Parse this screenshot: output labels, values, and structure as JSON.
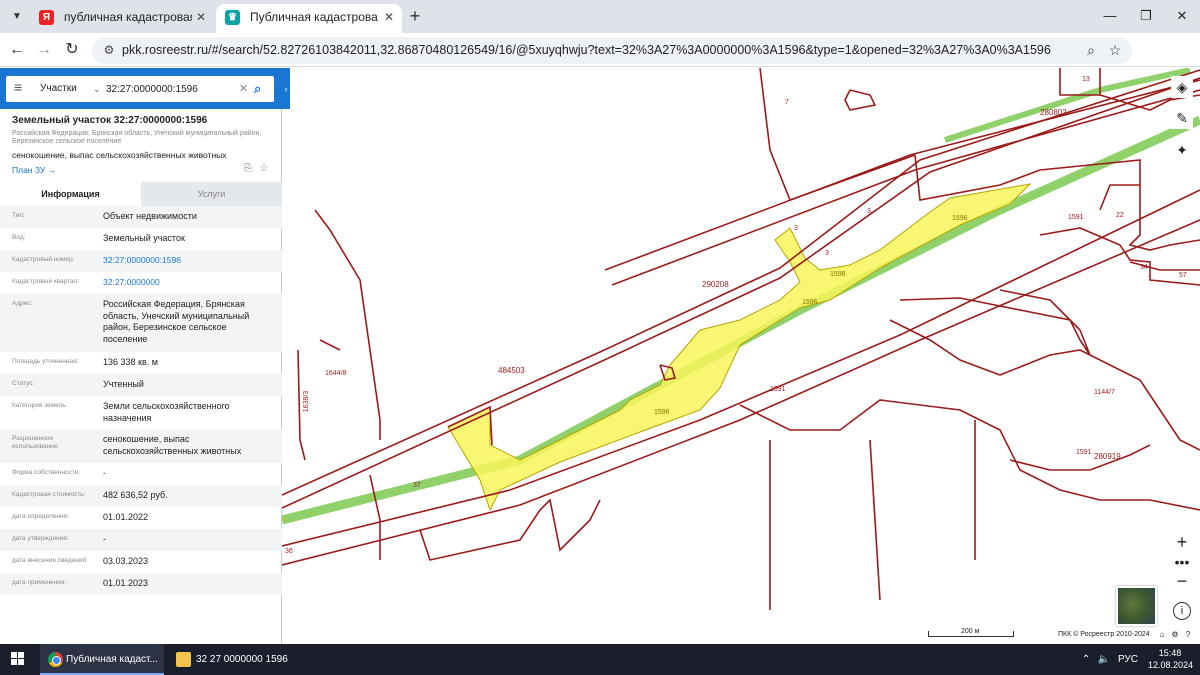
{
  "browser": {
    "tabs": [
      {
        "title": "публичная кадастровая карта",
        "favicon": "yandex-icon",
        "active": false
      },
      {
        "title": "Публичная кадастровая карта",
        "favicon": "rosreestr-icon",
        "active": true
      }
    ],
    "url": "pkk.rosreestr.ru/#/search/52.82726103842011,32.86870480126549/16/@5xuyqhwju?text=32%3A27%3A0000000%3A1596&type=1&opened=32%3A27%3A0%3A1596",
    "tab_close_glyph": "✕",
    "new_tab_glyph": "+"
  },
  "search": {
    "type_label": "Участки",
    "value": "32:27:0000000:1596"
  },
  "parcel": {
    "title": "Земельный участок 32:27:0000000:1596",
    "address_short": "Российская Федерация, Брянская область, Унечский муниципальный район, Березинское сельское поселение",
    "use": "сенокошение, выпас сельскохозяйственных животных",
    "plan_link": "План ЗУ →"
  },
  "panel_tabs": {
    "info": "Информация",
    "services": "Услуги"
  },
  "attributes": [
    {
      "key": "Тип:",
      "value": "Объект недвижимости",
      "link": false
    },
    {
      "key": "Вид:",
      "value": "Земельный участок",
      "link": false
    },
    {
      "key": "Кадастровый номер:",
      "value": "32:27:0000000:1596",
      "link": true
    },
    {
      "key": "Кадастровый квартал:",
      "value": "32:27:0000000",
      "link": true
    },
    {
      "key": "Адрес:",
      "value": "Российская Федерация, Брянская область, Унечский муниципальный район, Березинское сельское поселение",
      "link": false
    },
    {
      "key": "Площадь уточненная:",
      "value": "136 338 кв. м",
      "link": false
    },
    {
      "key": "Статус:",
      "value": "Учтенный",
      "link": false
    },
    {
      "key": "Категория земель:",
      "value": "Земли сельскохозяйственного назначения",
      "link": false
    },
    {
      "key": "Разрешенное использование:",
      "value": "сенокошение, выпас сельскохозяйственных животных",
      "link": false
    },
    {
      "key": "Форма собственности:",
      "value": "-",
      "link": false
    },
    {
      "key": "Кадастровая стоимость:",
      "value": "482 636,52 руб.",
      "link": false
    },
    {
      "key": "дата определения:",
      "value": "01.01.2022",
      "link": false
    },
    {
      "key": "дата утверждения:",
      "value": "-",
      "link": false
    },
    {
      "key": "дата внесения сведений:",
      "value": "03.03.2023",
      "link": false
    },
    {
      "key": "дата применения:",
      "value": "01.01.2023",
      "link": false
    }
  ],
  "map": {
    "labels": [
      "7",
      "13",
      "280802",
      "3",
      "3",
      "3",
      "1596",
      "1596",
      "1596",
      "1596",
      "1591",
      "22",
      "34",
      "57",
      "290208",
      "484503",
      "1644/8",
      "1638/3",
      "1591",
      "1144/7",
      "1591",
      "280919",
      "37",
      "36"
    ],
    "scale_label": "200 м",
    "copyright": "ПКК © Росреестр 2010-2024",
    "colors": {
      "boundary": "#9b1b1b",
      "parcel_fill": "#f7f55a",
      "road": "#8fd16a"
    }
  },
  "taskbar": {
    "items": [
      {
        "label": "Публичная кадаст...",
        "icon": "chrome-icon"
      },
      {
        "label": "32 27 0000000 1596",
        "icon": "folder-icon"
      }
    ],
    "lang": "РУС",
    "time": "15:48",
    "date": "12.08.2024"
  }
}
